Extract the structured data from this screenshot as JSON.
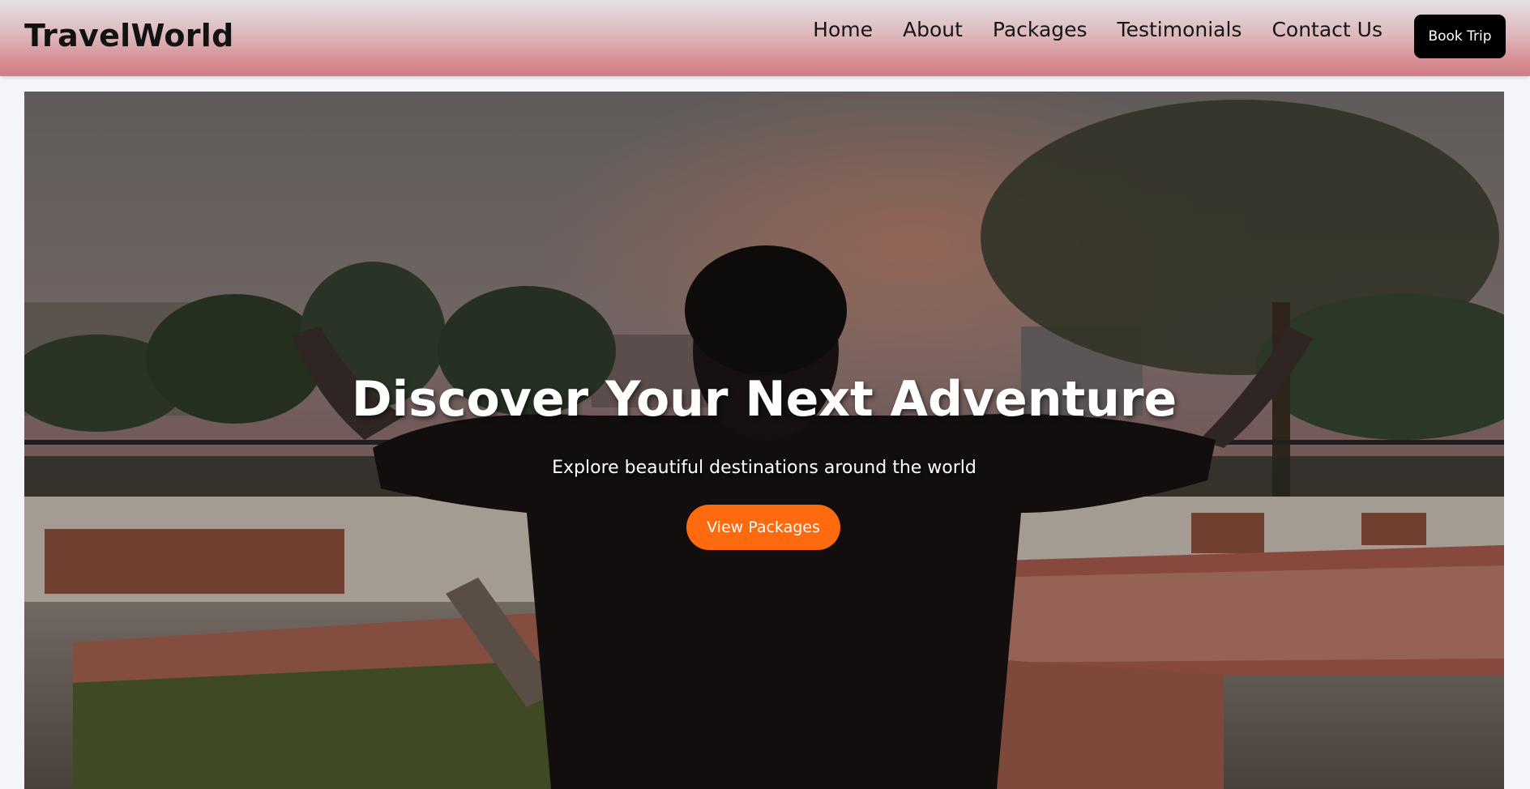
{
  "navbar": {
    "brand": "TravelWorld",
    "links": [
      {
        "label": "Home"
      },
      {
        "label": "About"
      },
      {
        "label": "Packages"
      },
      {
        "label": "Testimonials"
      },
      {
        "label": "Contact Us"
      }
    ],
    "book_button": "Book Trip"
  },
  "hero": {
    "title": "Discover Your Next Adventure",
    "subtitle": "Explore beautiful destinations around the world",
    "cta_label": "View Packages",
    "image_subject": "Person with raised arms facing a park at sunset"
  },
  "colors": {
    "cta_accent": "#ff6a0f",
    "book_button_bg": "#000000",
    "navbar_gradient_top": "#e4e0e3",
    "navbar_gradient_bottom": "#cf7e84",
    "page_background": "#f4f5f9"
  }
}
